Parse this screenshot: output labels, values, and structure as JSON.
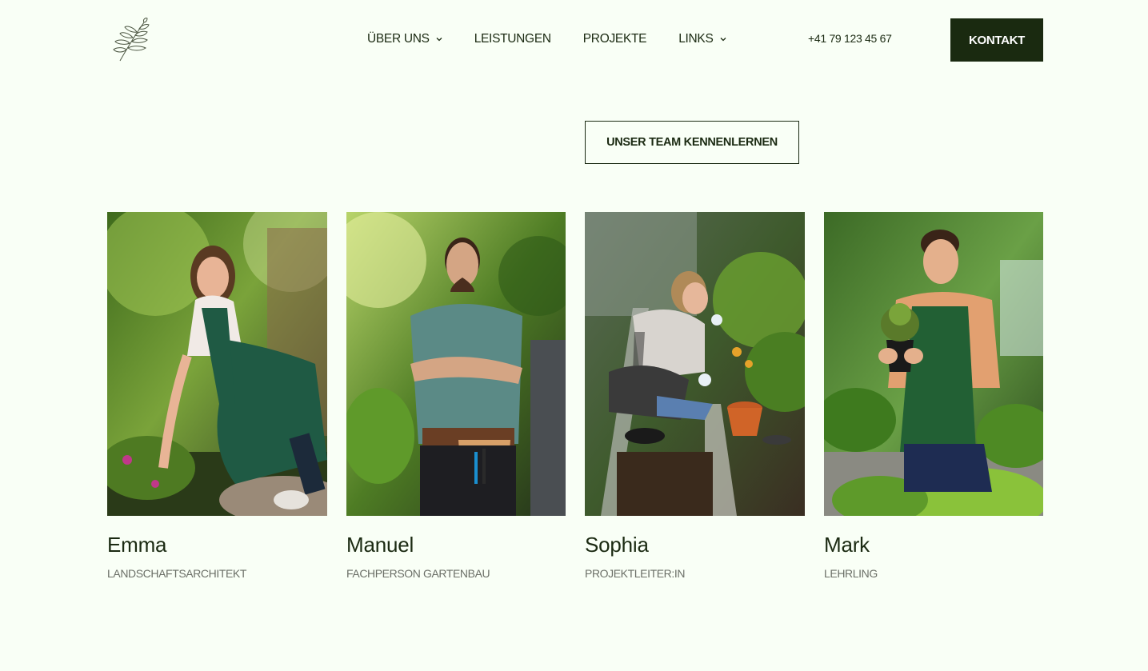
{
  "header": {
    "nav": [
      {
        "label": "ÜBER UNS",
        "has_dropdown": true
      },
      {
        "label": "LEISTUNGEN",
        "has_dropdown": false
      },
      {
        "label": "PROJEKTE",
        "has_dropdown": false
      },
      {
        "label": "LINKS",
        "has_dropdown": true
      }
    ],
    "phone": "+41 79 123 45 67",
    "contact_label": "KONTAKT",
    "logo_icon": "leaf-branch-icon"
  },
  "team_button_label": "UNSER TEAM KENNENLERNEN",
  "team": [
    {
      "name": "Emma",
      "role": "LANDSCHAFTSARCHITEKT",
      "photo": "gardener-woman-planting-photo"
    },
    {
      "name": "Manuel",
      "role": "FACHPERSON GARTENBAU",
      "photo": "gardener-man-arms-crossed-photo"
    },
    {
      "name": "Sophia",
      "role": "PROJEKTLEITER:IN",
      "photo": "gardener-woman-smelling-plant-photo"
    },
    {
      "name": "Mark",
      "role": "LEHRLING",
      "photo": "gardener-man-holding-pot-photo"
    }
  ],
  "colors": {
    "background": "#f9fff6",
    "dark_green": "#1a2a10",
    "text": "#1b2a12",
    "muted": "#6b6f67"
  }
}
